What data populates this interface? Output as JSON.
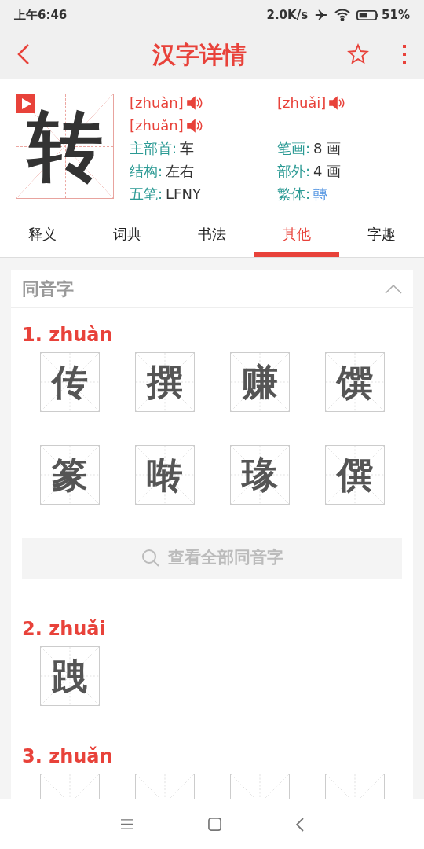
{
  "status_bar": {
    "time": "上午6:46",
    "speed": "2.0K/s",
    "battery": "51%"
  },
  "header": {
    "title": "汉字详情"
  },
  "character": {
    "glyph": "转",
    "pinyin": [
      {
        "text": "[zhuàn]"
      },
      {
        "text": "[zhuǎi]"
      },
      {
        "text": "[zhuǎn]"
      }
    ],
    "info": [
      {
        "label": "主部首:",
        "value": "车",
        "kind": "plain"
      },
      {
        "label": "笔画:",
        "value": "8 画",
        "kind": "plain"
      },
      {
        "label": "结构:",
        "value": "左右",
        "kind": "plain"
      },
      {
        "label": "部外:",
        "value": "4 画",
        "kind": "plain"
      },
      {
        "label": "五笔:",
        "value": "LFNY",
        "kind": "plain"
      },
      {
        "label": "繁体:",
        "value": "轉",
        "kind": "link"
      }
    ]
  },
  "tabs": [
    {
      "label": "释义",
      "selected": false
    },
    {
      "label": "词典",
      "selected": false
    },
    {
      "label": "书法",
      "selected": false
    },
    {
      "label": "其他",
      "selected": true
    },
    {
      "label": "字趣",
      "selected": false
    }
  ],
  "section": {
    "title": "同音字",
    "expanded": true,
    "groups": [
      {
        "heading": "1. zhuàn",
        "chars": [
          "传",
          "撰",
          "赚",
          "馔",
          "篆",
          "啭",
          "瑑",
          "僎"
        ],
        "more": "查看全部同音字"
      },
      {
        "heading": "2. zhuǎi",
        "chars": [
          "跩"
        ]
      },
      {
        "heading": "3. zhuǎn",
        "cells": [
          {
            "kind": "cut"
          },
          {
            "kind": "cut"
          },
          {
            "kind": "cut"
          },
          {
            "kind": "cut"
          }
        ]
      }
    ]
  }
}
